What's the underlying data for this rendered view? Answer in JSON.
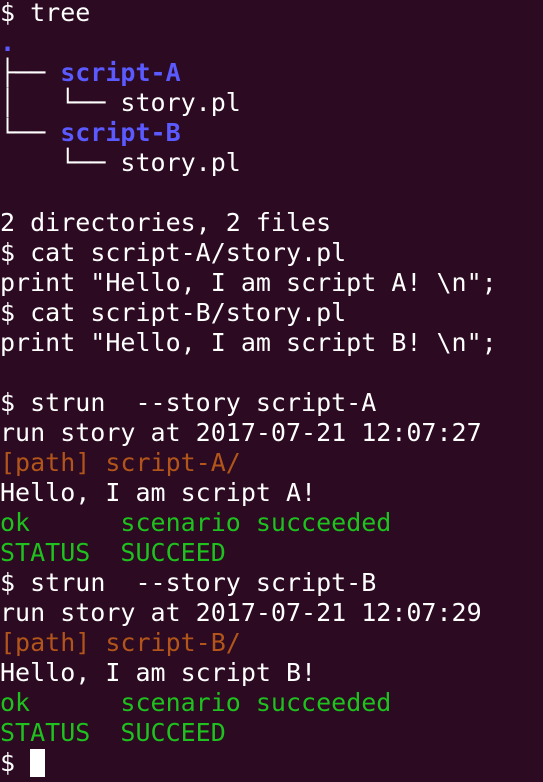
{
  "prompt": "$ ",
  "tree_cmd": "tree",
  "tree": {
    "root": ".",
    "branch_mid": "├── ",
    "branch_sub_indent": "│   └── ",
    "branch_last": "└── ",
    "branch_last_sub_indent": "    └── ",
    "dir_a": "script-A",
    "file_a": "story.pl",
    "dir_b": "script-B",
    "file_b": "story.pl"
  },
  "summary": "2 directories, 2 files",
  "cat_a_cmd": "cat script-A/story.pl",
  "cat_a_out": "print \"Hello, I am script A! \\n\";",
  "cat_b_cmd": "cat script-B/story.pl",
  "cat_b_out": "print \"Hello, I am script B! \\n\";",
  "run_a": {
    "cmd": "strun  --story script-A",
    "at": "run story at 2017-07-21 12:07:27",
    "path": "[path] script-A/",
    "hello": "Hello, I am script A!",
    "ok": "ok",
    "scenario": "scenario succeeded",
    "status_label": "STATUS",
    "status_value": "SUCCEED"
  },
  "run_b": {
    "cmd": "strun  --story script-B",
    "at": "run story at 2017-07-21 12:07:29",
    "path": "[path] script-B/",
    "hello": "Hello, I am script B!",
    "ok": "ok",
    "scenario": "scenario succeeded",
    "status_label": "STATUS",
    "status_value": "SUCCEED"
  },
  "final_prompt": "$ "
}
